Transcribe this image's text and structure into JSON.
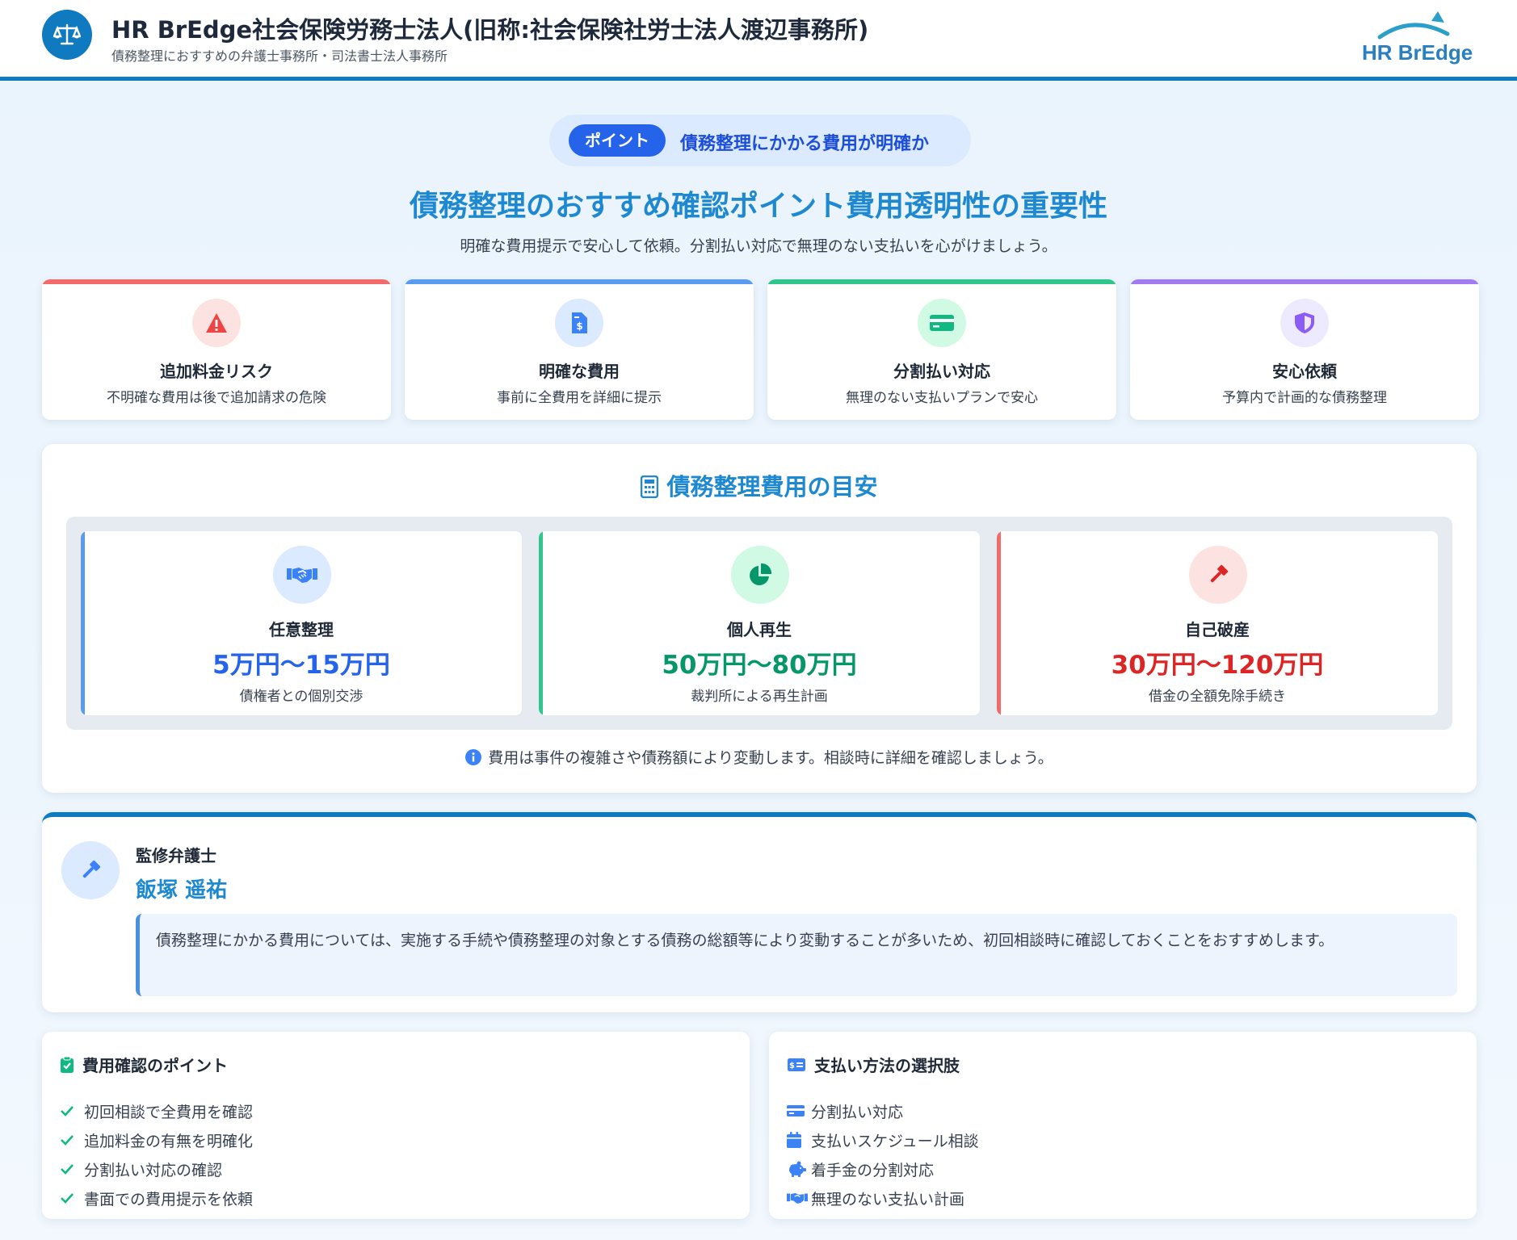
{
  "header": {
    "title": "HR BrEdge社会保険労務士法人(旧称:社会保険社労士法人渡辺事務所)",
    "subtitle": "債務整理におすすめの弁護士事務所・司法書士法人事務所",
    "brand_logo_text": "HR BrEdge"
  },
  "hero": {
    "badge": "ポイント",
    "point_text": "債務整理にかかる費用が明確か",
    "title": "債務整理のおすすめ確認ポイント費用透明性の重要性",
    "subtitle": "明確な費用提示で安心して依頼。分割払い対応で無理のない支払いを心がけましょう。"
  },
  "features": [
    {
      "icon": "warning-icon",
      "title": "追加料金リスク",
      "desc": "不明確な費用は後で追加請求の危険",
      "color": "#ef4444"
    },
    {
      "icon": "invoice-dollar-icon",
      "title": "明確な費用",
      "desc": "事前に全費用を詳細に提示",
      "color": "#3b82f6"
    },
    {
      "icon": "credit-card-icon",
      "title": "分割払い対応",
      "desc": "無理のない支払いプランで安心",
      "color": "#10b981"
    },
    {
      "icon": "shield-icon",
      "title": "安心依頼",
      "desc": "予算内で計画的な債務整理",
      "color": "#8b5cf6"
    }
  ],
  "cost": {
    "heading": "債務整理費用の目安",
    "items": [
      {
        "icon": "handshake-icon",
        "name": "任意整理",
        "price": "5万円〜15万円",
        "desc": "債権者との個別交渉",
        "color": "#2563eb"
      },
      {
        "icon": "pie-chart-icon",
        "name": "個人再生",
        "price": "50万円〜80万円",
        "desc": "裁判所による再生計画",
        "color": "#059669"
      },
      {
        "icon": "gavel-icon",
        "name": "自己破産",
        "price": "30万円〜120万円",
        "desc": "借金の全額免除手続き",
        "color": "#dc2626"
      }
    ],
    "note": "費用は事件の複雑さや債務額により変動します。相談時に詳細を確認しましょう。"
  },
  "supervisor": {
    "role": "監修弁護士",
    "name": "飯塚 遥祐",
    "quote": "債務整理にかかる費用については、実施する手続や債務整理の対象とする債務の総額等により変動することが多いため、初回相談時に確認しておくことをおすすめします。"
  },
  "check_points": {
    "title": "費用確認のポイント",
    "items": [
      "初回相談で全費用を確認",
      "追加料金の有無を明確化",
      "分割払い対応の確認",
      "書面での費用提示を依頼"
    ]
  },
  "payment_options": {
    "title": "支払い方法の選択肢",
    "items": [
      {
        "icon": "credit-card-icon",
        "label": "分割払い対応"
      },
      {
        "icon": "calendar-icon",
        "label": "支払いスケジュール相談"
      },
      {
        "icon": "piggy-bank-icon",
        "label": "着手金の分割対応"
      },
      {
        "icon": "handshake-icon",
        "label": "無理のない支払い計画"
      }
    ]
  }
}
